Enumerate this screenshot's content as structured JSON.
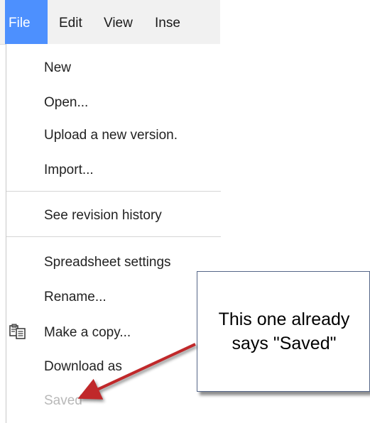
{
  "menubar": {
    "items": [
      {
        "label": "File",
        "active": true
      },
      {
        "label": "Edit",
        "active": false
      },
      {
        "label": "View",
        "active": false
      },
      {
        "label": "Inse",
        "active": false
      }
    ]
  },
  "file_menu": {
    "items": [
      {
        "label": "New",
        "enabled": true
      },
      {
        "label": "Open...",
        "enabled": true
      },
      {
        "label": "Upload a new version.",
        "enabled": true
      },
      {
        "label": "Import...",
        "enabled": true
      },
      {
        "label": "See revision history",
        "enabled": true
      },
      {
        "label": "Spreadsheet settings",
        "enabled": true
      },
      {
        "label": "Rename...",
        "enabled": true
      },
      {
        "label": "Make a copy...",
        "enabled": true,
        "icon": "copy-icon"
      },
      {
        "label": "Download as",
        "enabled": true
      },
      {
        "label": "Saved",
        "enabled": false
      }
    ]
  },
  "callout": {
    "line1": "This one already",
    "line2": "says \"Saved\"",
    "arrow_color": "#c0282a"
  },
  "colors": {
    "menubar_bg": "#f1f1f1",
    "active_menu_bg": "#4d90fe",
    "disabled_text": "#b8b8b8"
  }
}
